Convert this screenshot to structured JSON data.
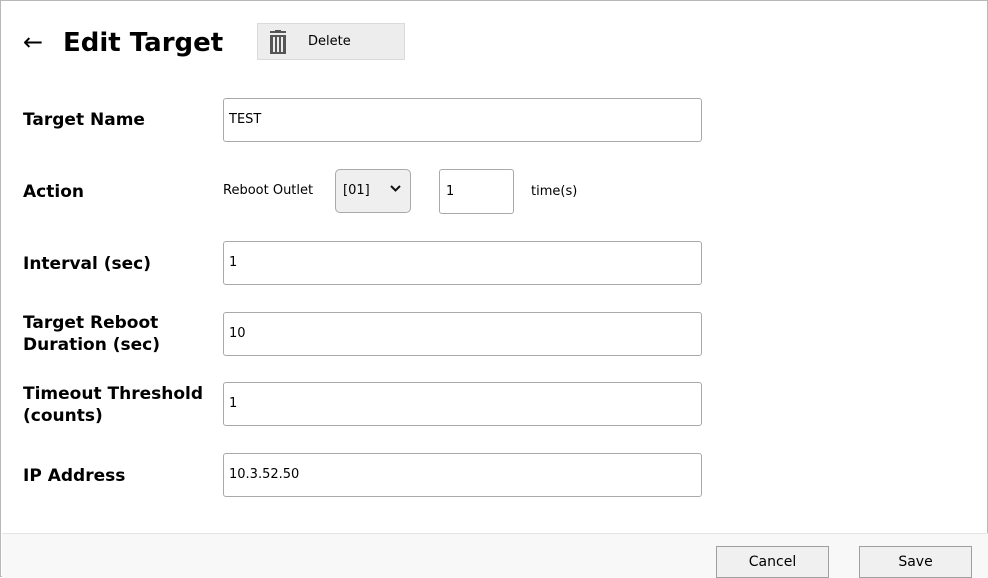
{
  "header": {
    "title": "Edit Target",
    "delete_label": "Delete"
  },
  "form": {
    "target_name": {
      "label": "Target Name",
      "value": "TEST"
    },
    "action": {
      "label": "Action",
      "type_text": "Reboot Outlet",
      "outlet_selected": "[01]",
      "times_value": "1",
      "times_unit": "time(s)"
    },
    "interval": {
      "label": "Interval (sec)",
      "value": "1"
    },
    "reboot_duration": {
      "label_line1": "Target Reboot",
      "label_line2": "Duration (sec)",
      "value": "10"
    },
    "timeout_threshold": {
      "label_line1": "Timeout Threshold",
      "label_line2": "(counts)",
      "value": "1"
    },
    "ip_address": {
      "label": "IP Address",
      "value": "10.3.52.50"
    }
  },
  "footer": {
    "cancel_label": "Cancel",
    "save_label": "Save"
  },
  "icons": {
    "back": "back-arrow-icon",
    "delete": "trash-icon",
    "dropdown": "chevron-down-icon"
  },
  "colors": {
    "border": "#a9a9a9",
    "button_bg": "#ededed",
    "footer_bg": "#f8f8f8",
    "icon": "#555555"
  }
}
